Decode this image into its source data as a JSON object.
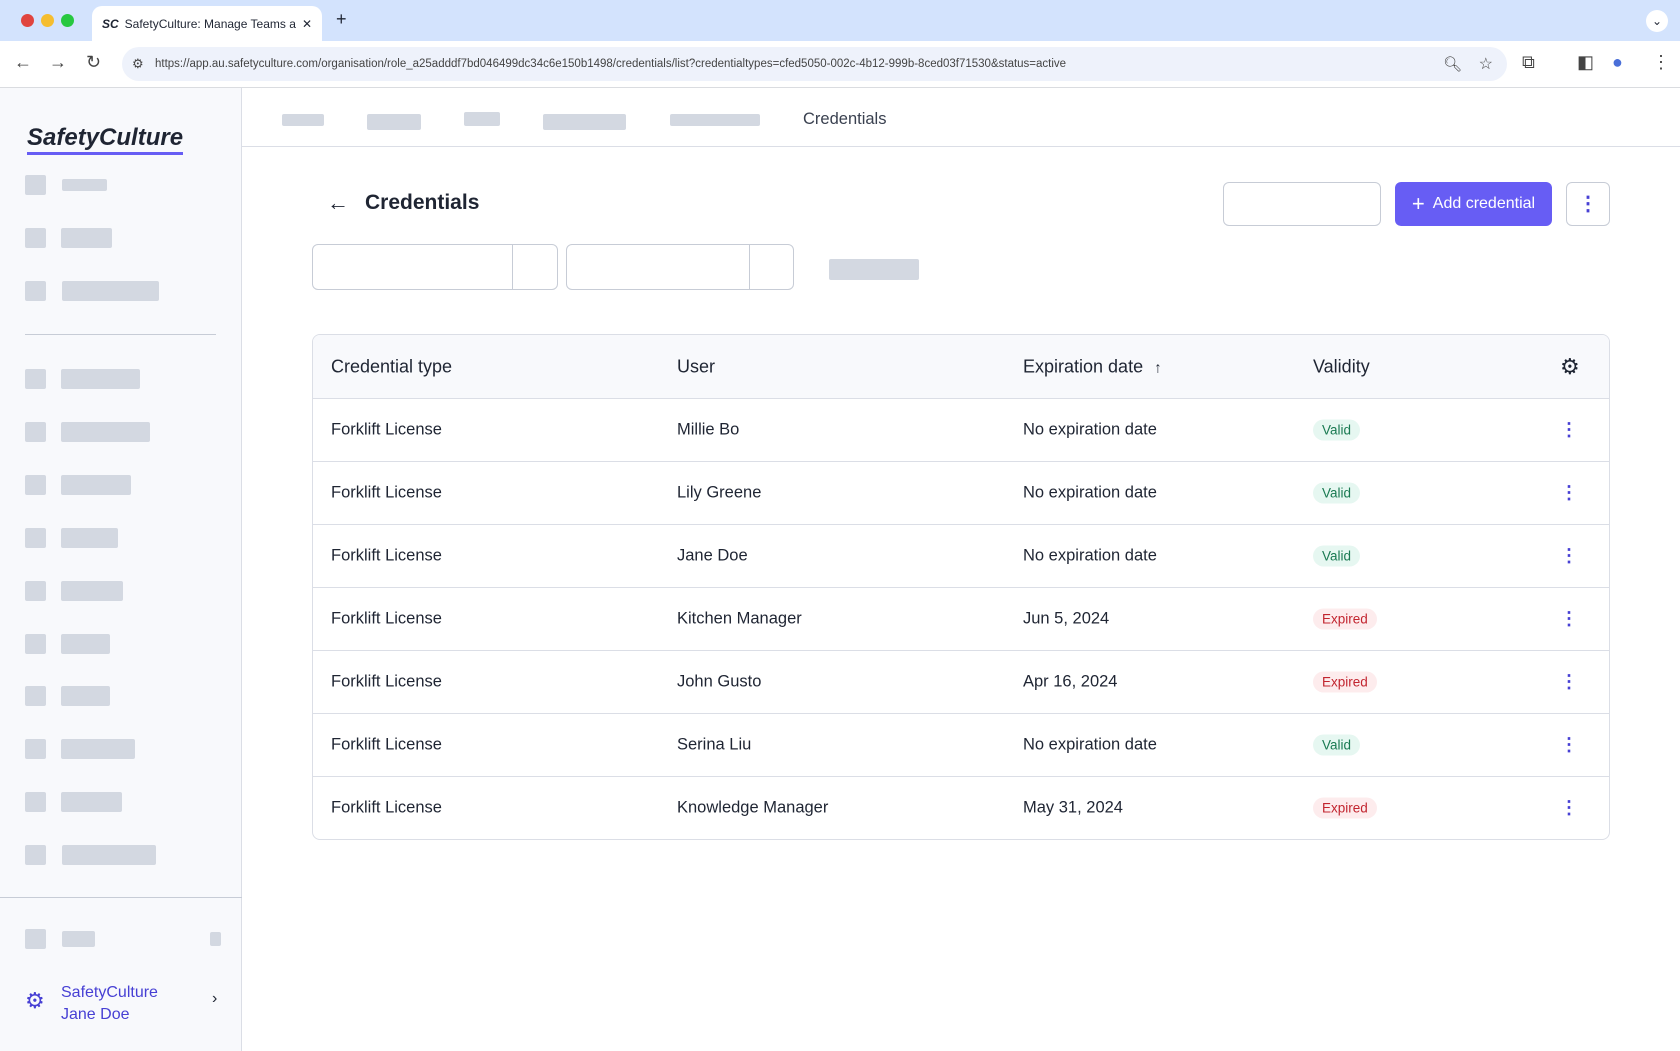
{
  "browser": {
    "tab_title": "SafetyCulture: Manage Teams and...",
    "url": "https://app.au.safetyculture.com/organisation/role_a25adddf7bd046499dc34c6e150b1498/credentials/list?credentialtypes=cfed5050-002c-4b12-999b-8ced03f71530&status=active"
  },
  "sidebar": {
    "logo": "SafetyCulture",
    "org_name": "SafetyCulture",
    "user_name": "Jane Doe"
  },
  "breadcrumb": {
    "current": "Credentials"
  },
  "page": {
    "title": "Credentials",
    "add_button": "Add credential"
  },
  "table": {
    "headers": [
      "Credential type",
      "User",
      "Expiration date",
      "Validity"
    ],
    "sort_indicator": "↑",
    "rows": [
      {
        "type": "Forklift License",
        "user": "Millie Bo",
        "expiration": "No expiration date",
        "validity": "Valid"
      },
      {
        "type": "Forklift License",
        "user": "Lily Greene",
        "expiration": "No expiration date",
        "validity": "Valid"
      },
      {
        "type": "Forklift License",
        "user": "Jane Doe",
        "expiration": "No expiration date",
        "validity": "Valid"
      },
      {
        "type": "Forklift License",
        "user": "Kitchen Manager",
        "expiration": "Jun 5, 2024",
        "validity": "Expired"
      },
      {
        "type": "Forklift License",
        "user": "John Gusto",
        "expiration": "Apr 16, 2024",
        "validity": "Expired"
      },
      {
        "type": "Forklift License",
        "user": "Serina Liu",
        "expiration": "No expiration date",
        "validity": "Valid"
      },
      {
        "type": "Forklift License",
        "user": "Knowledge Manager",
        "expiration": "May 31, 2024",
        "validity": "Expired"
      }
    ]
  },
  "colors": {
    "accent": "#675df4",
    "valid": "#1a7a52",
    "expired": "#c2252f"
  }
}
